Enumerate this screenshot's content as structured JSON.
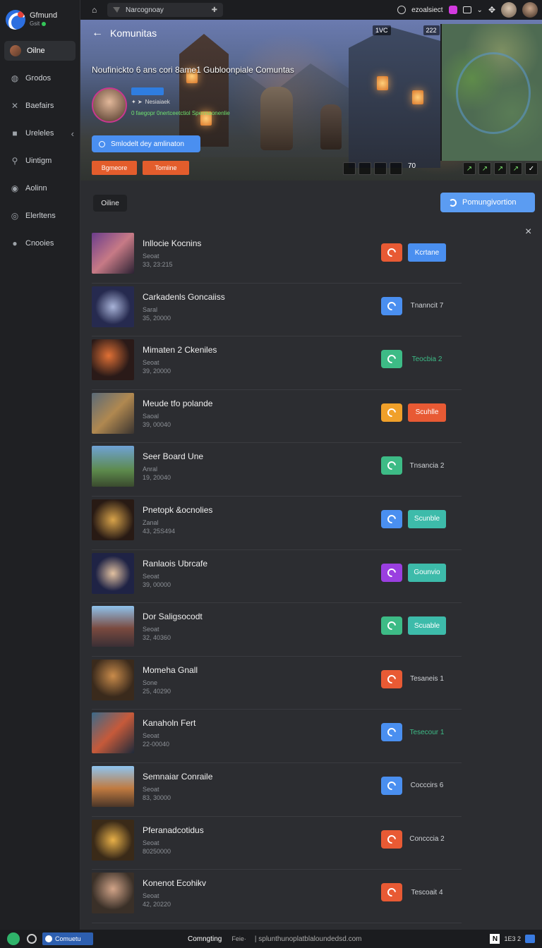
{
  "brand": {
    "name": "Gfmund",
    "status": "Gsit"
  },
  "sidebar": {
    "items": [
      {
        "label": "Oilne",
        "icon": "avatar",
        "active": true
      },
      {
        "label": "Grodos",
        "icon": "grid-icon"
      },
      {
        "label": "Baefairs",
        "icon": "tools-icon"
      },
      {
        "label": "Ureleles",
        "icon": "folder-icon",
        "chevron": "‹"
      },
      {
        "label": "Uintigm",
        "icon": "pin-icon"
      },
      {
        "label": "Aolinn",
        "icon": "target-icon"
      },
      {
        "label": "Elerltens",
        "icon": "eye-icon"
      },
      {
        "label": "Cnooies",
        "icon": "user-icon"
      }
    ]
  },
  "topbar": {
    "tab_label": "Narcognoay",
    "right_label": "ezoalsiect",
    "icons": [
      "home-icon",
      "puzzle-icon",
      "clock-icon",
      "flag-icon",
      "window-icon",
      "chevron-down-icon",
      "move-icon"
    ]
  },
  "hero": {
    "title": "Komunitas",
    "subtitle": "Noufinickto 6 ans cori 8ame1 Gubloonpiale Comuntas",
    "badge": "",
    "line1": "Nesiaiaek",
    "line2": "0 faegopr 0nertceetctiol Spermaonenlie",
    "join_label": "Smlodelt dey amlinaton",
    "tag1": "Bgmeore",
    "tag2": "Tomiine",
    "hud": [
      "1VC",
      "222"
    ],
    "hud_bottom_label": "70"
  },
  "main": {
    "filter_chip": "Oiline",
    "primary_button": "Pomungivortion",
    "close_label": "×"
  },
  "rows": [
    {
      "title": "Inllocie Kocnins",
      "sub1": "Seoat",
      "sub2": "33, 23:215",
      "ico_color": "#e85a34",
      "status": "Kcrtane",
      "status_btn": true,
      "status_color": "#4a8ff0",
      "thumb": "linear-gradient(135deg,#6b3d8c,#c77a86 50%,#2c2233)"
    },
    {
      "title": "Carkadenls Goncaiiss",
      "sub1": "Saral",
      "sub2": "35, 20000",
      "ico_color": "#4a8ff0",
      "status": "Tnanncit 7",
      "status_btn": false,
      "status_color": "",
      "thumb": "radial-gradient(circle at 50% 50%,#a8b3d8,#262a4f 60%)"
    },
    {
      "title": "Mimaten 2 Ckeniles",
      "sub1": "Seoat",
      "sub2": "39, 20000",
      "ico_color": "#3dbb86",
      "status": "Teocbia 2",
      "status_btn": false,
      "status_color": "",
      "status_text_color": "#3dbb86",
      "thumb": "radial-gradient(circle at 40% 40%,#e07035,#2a1a18 60%)"
    },
    {
      "title": "Meude tfo polande",
      "sub1": "Saoal",
      "sub2": "39, 00040",
      "ico_color": "#f0a02a",
      "status": "Scuhlle",
      "status_btn": true,
      "status_color": "#e85a34",
      "thumb": "linear-gradient(135deg,#5a6a78,#b08850 50%,#3a3430)"
    },
    {
      "title": "Seer Board Une",
      "sub1": "Anral",
      "sub2": "19, 20040",
      "ico_color": "#3dbb86",
      "status": "Tnsancia 2",
      "status_btn": false,
      "status_color": "",
      "thumb": "linear-gradient(180deg,#6fa2d6,#5d8a4c 60%,#3a4a2e)"
    },
    {
      "title": "Pnetopk &ocnolies",
      "sub1": "Zanal",
      "sub2": "43, 25S494",
      "ico_color": "#4a8ff0",
      "status": "Scunble",
      "status_btn": true,
      "status_color": "#3dbbaa",
      "thumb": "radial-gradient(circle at 50% 50%,#d8a34a,#281a14 70%)"
    },
    {
      "title": "Ranlaois Ubrcafe",
      "sub1": "Seoat",
      "sub2": "39, 00000",
      "ico_color": "#9a3fe0",
      "status": "Gounvio",
      "status_btn": true,
      "status_color": "#3dbbaa",
      "thumb": "radial-gradient(circle at 50% 50%,#e2c1a0,#1f2345 60%)"
    },
    {
      "title": "Dor Saligsocodt",
      "sub1": "Seoat",
      "sub2": "32, 40360",
      "ico_color": "#3dbb86",
      "status": "Scuable",
      "status_btn": true,
      "status_color": "#3dbbaa",
      "thumb": "linear-gradient(180deg,#8fc2ec,#7a4a3f 55%,#3a2f35)"
    },
    {
      "title": "Momeha Gnall",
      "sub1": "Sone",
      "sub2": "25, 40290",
      "ico_color": "#e85a34",
      "status": "Tesaneis 1",
      "status_btn": false,
      "status_color": "",
      "thumb": "radial-gradient(circle at 50% 40%,#c98b4a,#3a2a1c 65%)"
    },
    {
      "title": "Kanaholn Fert",
      "sub1": "Seoat",
      "sub2": "22-00040",
      "ico_color": "#4a8ff0",
      "status": "Tesecour 1",
      "status_btn": false,
      "status_color": "",
      "status_text_color": "#3dbb86",
      "thumb": "linear-gradient(135deg,#3a6a8a,#c65a3a 50%,#1e2a3a)"
    },
    {
      "title": "Semnaiar Conraile",
      "sub1": "Seoat",
      "sub2": "83, 30000",
      "ico_color": "#4a8ff0",
      "status": "Cocccirs 6",
      "status_btn": false,
      "status_color": "",
      "thumb": "linear-gradient(180deg,#8ec4f0,#c07a40 55%,#4a3528)"
    },
    {
      "title": "Pferanadcotidus",
      "sub1": "Seoat",
      "sub2": "80250000",
      "ico_color": "#e85a34",
      "status": "Concccia 2",
      "status_btn": false,
      "status_color": "",
      "thumb": "radial-gradient(circle at 50% 50%,#e8b048,#3a2a18 65%)"
    },
    {
      "title": "Konenot Ecohikv",
      "sub1": "Seoat",
      "sub2": "42, 20220",
      "ico_color": "#e85a34",
      "status": "Tescoait 4",
      "status_btn": false,
      "status_color": "",
      "thumb": "radial-gradient(circle at 50% 40%,#d2a488,#3a3028 65%)"
    }
  ],
  "bottombar": {
    "chip_label": "Comuetu",
    "mid_label": "Comngting",
    "mid2_label": "Feie·",
    "url": "| splunthunoplatblaloundedsd.com",
    "right_label": "1E3 2"
  }
}
